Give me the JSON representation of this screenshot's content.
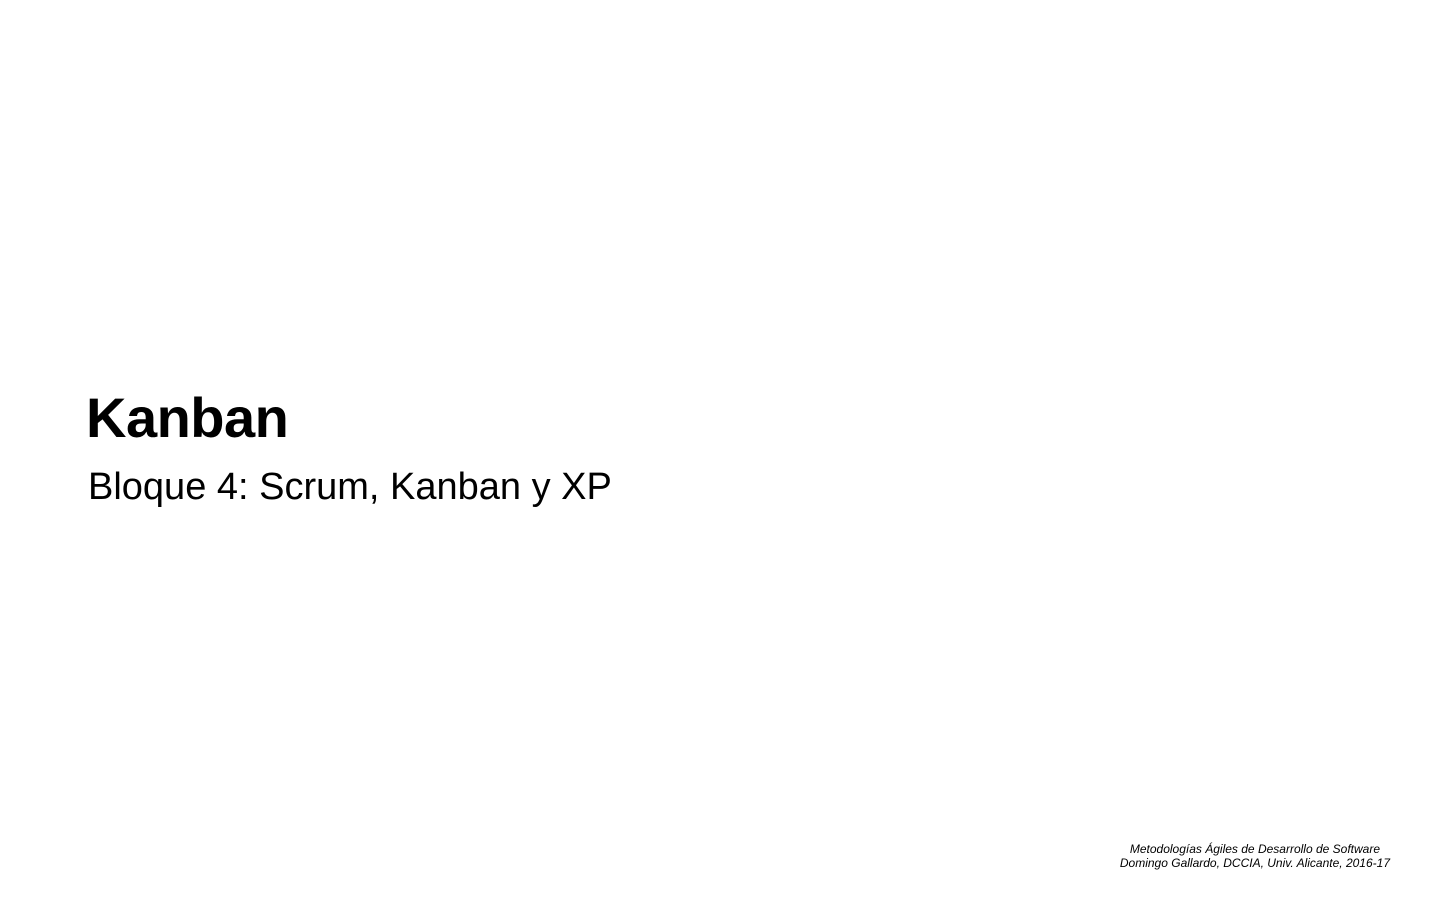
{
  "slide": {
    "title": "Kanban",
    "subtitle": "Bloque 4: Scrum, Kanban y XP",
    "footer": {
      "line1": "Metodologías Ágiles de Desarrollo de Software",
      "line2": "Domingo Gallardo, DCCIA, Univ. Alicante, 2016-17"
    }
  }
}
